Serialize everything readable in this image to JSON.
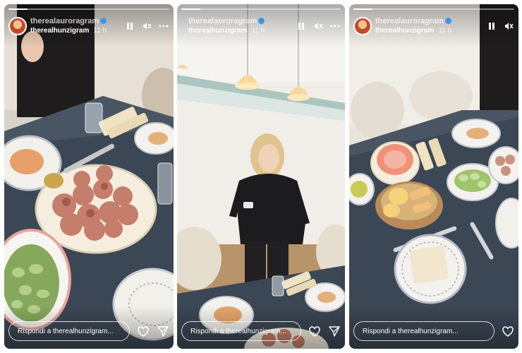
{
  "panels": [
    {
      "collaborator": "therealauroragram",
      "author": "therealhunzigram",
      "time": "11 h",
      "reply_placeholder": "Rispondi a therealhunzigram...",
      "progress": 0.12
    },
    {
      "collaborator": "therealauroragram",
      "author": "therealhunzigram",
      "time": "11 h",
      "reply_placeholder": "Rispondi a therealhunzigram...",
      "progress": 0.12
    },
    {
      "collaborator": "therealauroragram",
      "author": "therealhunzigram",
      "time": "11 h",
      "reply_placeholder": "Rispondi a therealhunzigram...",
      "progress": 0.12
    }
  ],
  "icons": {
    "pause": "pause-icon",
    "mute": "mute-icon",
    "more": "more-icon",
    "heart": "heart-icon",
    "send": "send-icon",
    "verified": "verified-badge"
  },
  "colors": {
    "white": "#ffffff",
    "verified": "#3897f0",
    "tablecloth": "#3c4755"
  }
}
